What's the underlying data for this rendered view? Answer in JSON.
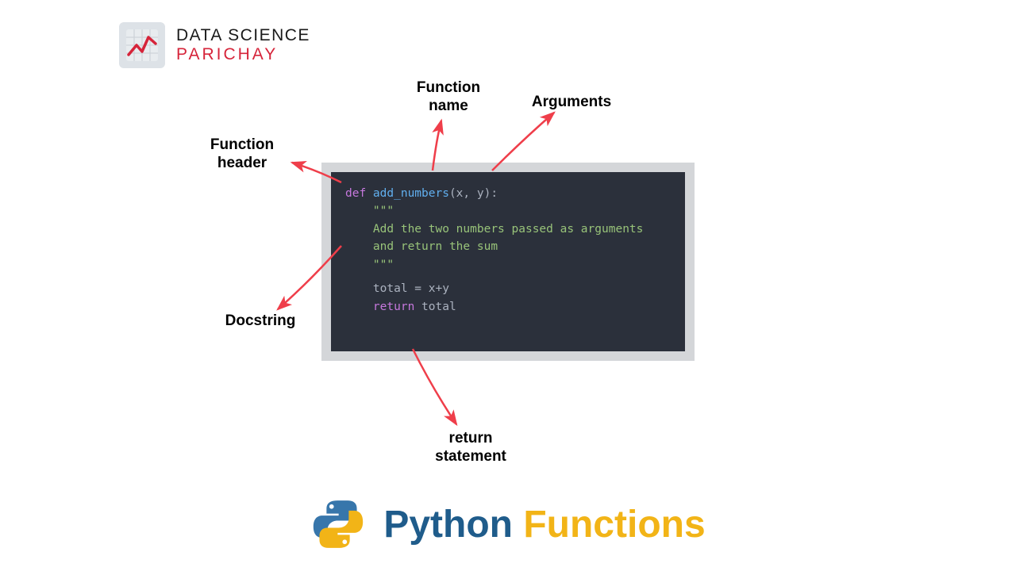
{
  "brand": {
    "line1": "DATA SCIENCE",
    "line2": "PARICHAY"
  },
  "labels": {
    "function_name": "Function\nname",
    "arguments": "Arguments",
    "function_header": "Function\nheader",
    "docstring": "Docstring",
    "return_statement": "return\nstatement"
  },
  "code": {
    "def": "def ",
    "fn_name": "add_numbers",
    "params": "(x, y)",
    "colon": ":",
    "quotes_open": "    \"\"\"",
    "doc_line1": "    Add the two numbers passed as arguments",
    "doc_line2": "    and return the sum",
    "quotes_close": "    \"\"\"",
    "assign": "    total = x+y",
    "return_kw": "    return ",
    "return_val": "total"
  },
  "footer": {
    "word1": "Python ",
    "word2": "Functions"
  },
  "colors": {
    "arrow": "#ef3e4a"
  }
}
